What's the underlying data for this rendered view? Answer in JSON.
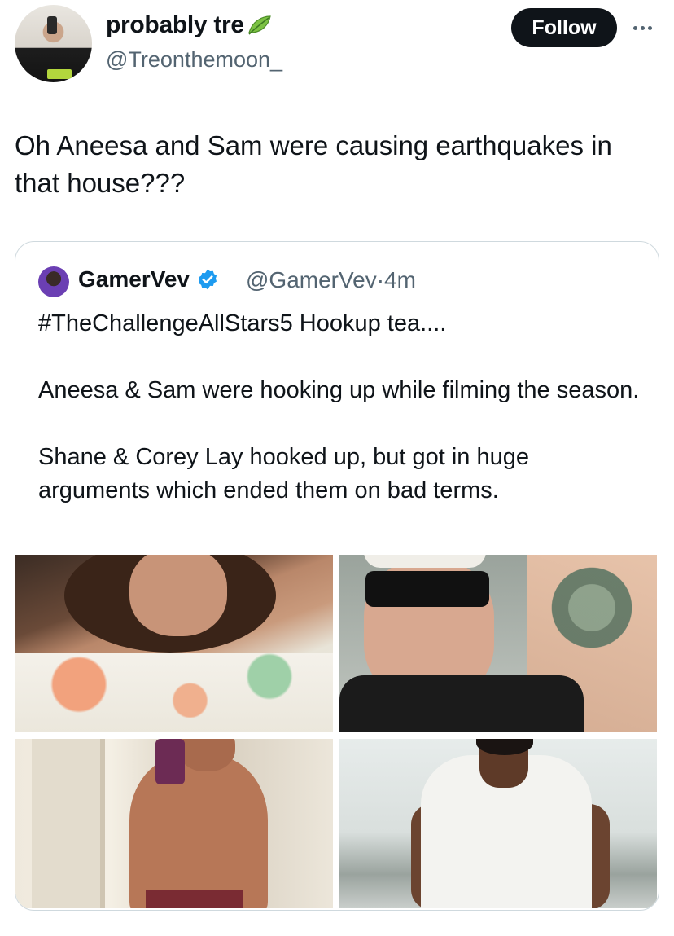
{
  "author": {
    "display_name": "probably tre",
    "handle": "@Treonthemoon_",
    "name_emoji": "leaf-icon"
  },
  "follow_label": "Follow",
  "tweet": {
    "text": "Oh Aneesa and Sam were causing earthquakes in that house???"
  },
  "quoted": {
    "name": "GamerVev",
    "handle": "@GamerVev",
    "separator": "·",
    "time": "4m",
    "verified": true,
    "verified_color": "#1d9bf0",
    "paragraphs": [
      "#TheChallengeAllStars5 Hookup tea....",
      "Aneesa & Sam were hooking up while filming the season.",
      "Shane & Corey Lay hooked up, but got in huge arguments which ended them on bad terms."
    ],
    "media": [
      {
        "name": "media-photo-1"
      },
      {
        "name": "media-photo-2"
      },
      {
        "name": "media-photo-3"
      },
      {
        "name": "media-photo-4"
      }
    ]
  },
  "colors": {
    "text_primary": "#0f1419",
    "text_secondary": "#536471",
    "follow_bg": "#0f1419",
    "border": "#cfd9de"
  }
}
